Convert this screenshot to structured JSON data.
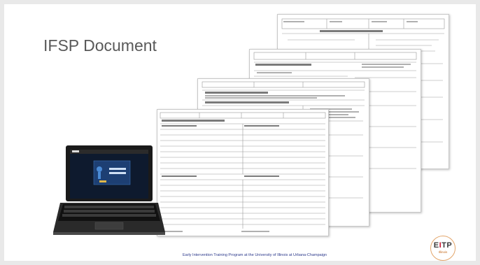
{
  "slide": {
    "title": "IFSP Document",
    "footer": "Early Intervention Training Program at the University of Illinois at Urbana-Champaign"
  },
  "logo": {
    "main": "EITP",
    "sub": "Illinois"
  },
  "colors": {
    "title": "#595959",
    "footer": "#2d3a8c",
    "logo_ring": "#e3a56a",
    "logo_accent": "#c8102e"
  }
}
